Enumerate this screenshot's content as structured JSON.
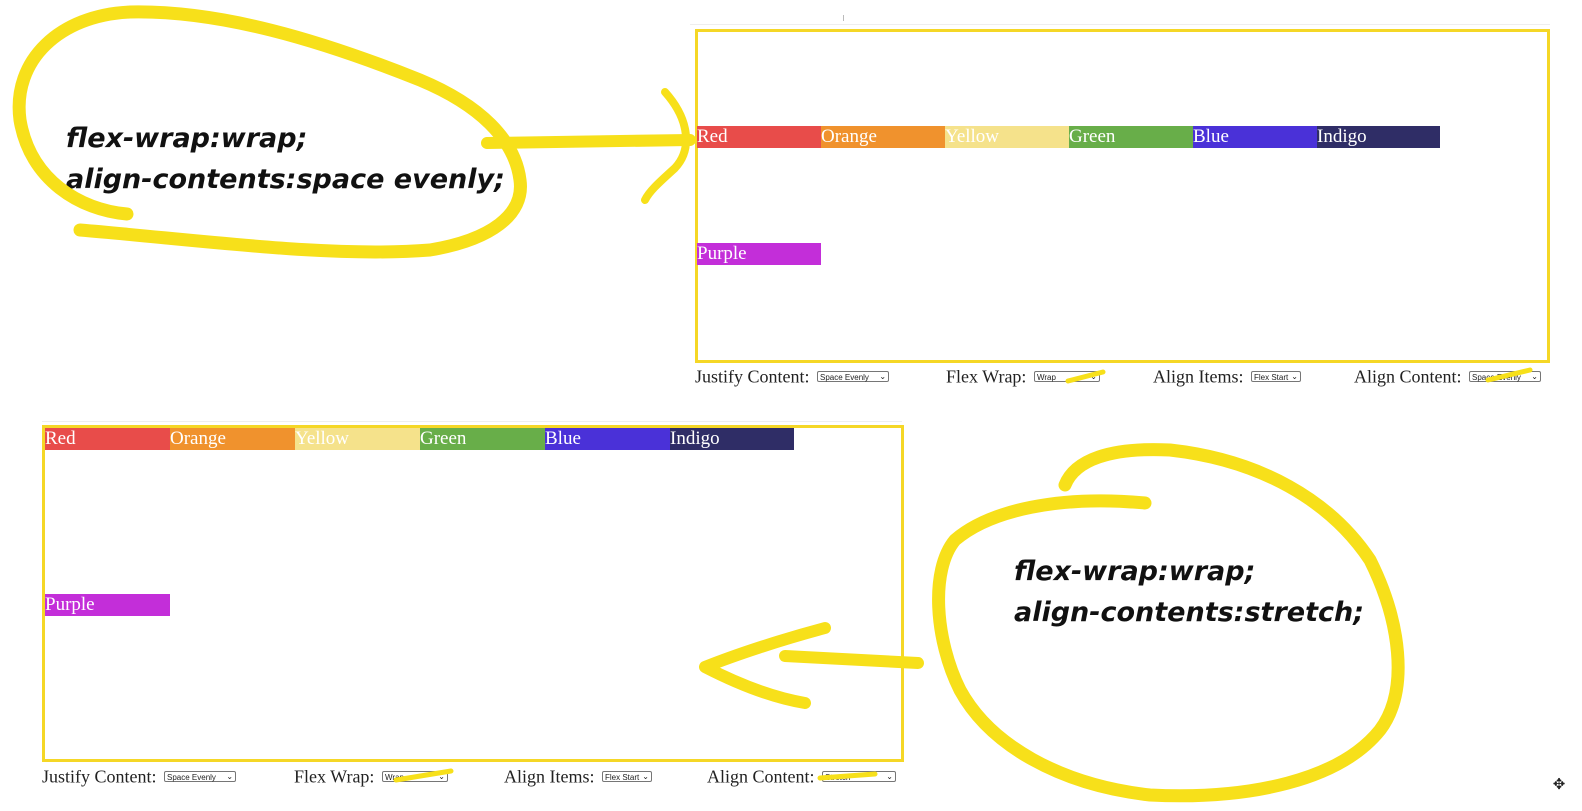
{
  "colors": {
    "highlight": "#f5d726",
    "items": {
      "Red": "#e84c4a",
      "Orange": "#f0922d",
      "Yellow": "#f5e28b",
      "Green": "#68ae49",
      "Blue": "#4a31d8",
      "Indigo": "#2f2d66",
      "Purple": "#c32ed9"
    }
  },
  "notes": {
    "top": {
      "line1": "flex-wrap:wrap;",
      "line2": "align-contents:space evenly;"
    },
    "bottom": {
      "line1": "flex-wrap:wrap;",
      "line2": "align-contents:stretch;"
    }
  },
  "demo_top": {
    "items": [
      "Red",
      "Orange",
      "Yellow",
      "Green",
      "Blue",
      "Indigo",
      "Purple"
    ],
    "controls": {
      "justify_label": "Justify Content:",
      "justify_value": "Space Evenly",
      "wrap_label": "Flex Wrap:",
      "wrap_value": "Wrap",
      "align_items_label": "Align Items:",
      "align_items_value": "Flex Start",
      "align_content_label": "Align Content:",
      "align_content_value": "Space Evenly"
    }
  },
  "demo_bottom": {
    "items": [
      "Red",
      "Orange",
      "Yellow",
      "Green",
      "Blue",
      "Indigo",
      "Purple"
    ],
    "controls": {
      "justify_label": "Justify Content:",
      "justify_value": "Space Evenly",
      "wrap_label": "Flex Wrap:",
      "wrap_value": "Wrap",
      "align_items_label": "Align Items:",
      "align_items_value": "Flex Start",
      "align_content_label": "Align Content:",
      "align_content_value": "Stretch"
    }
  },
  "icons": {
    "move": "move-handle-icon"
  }
}
